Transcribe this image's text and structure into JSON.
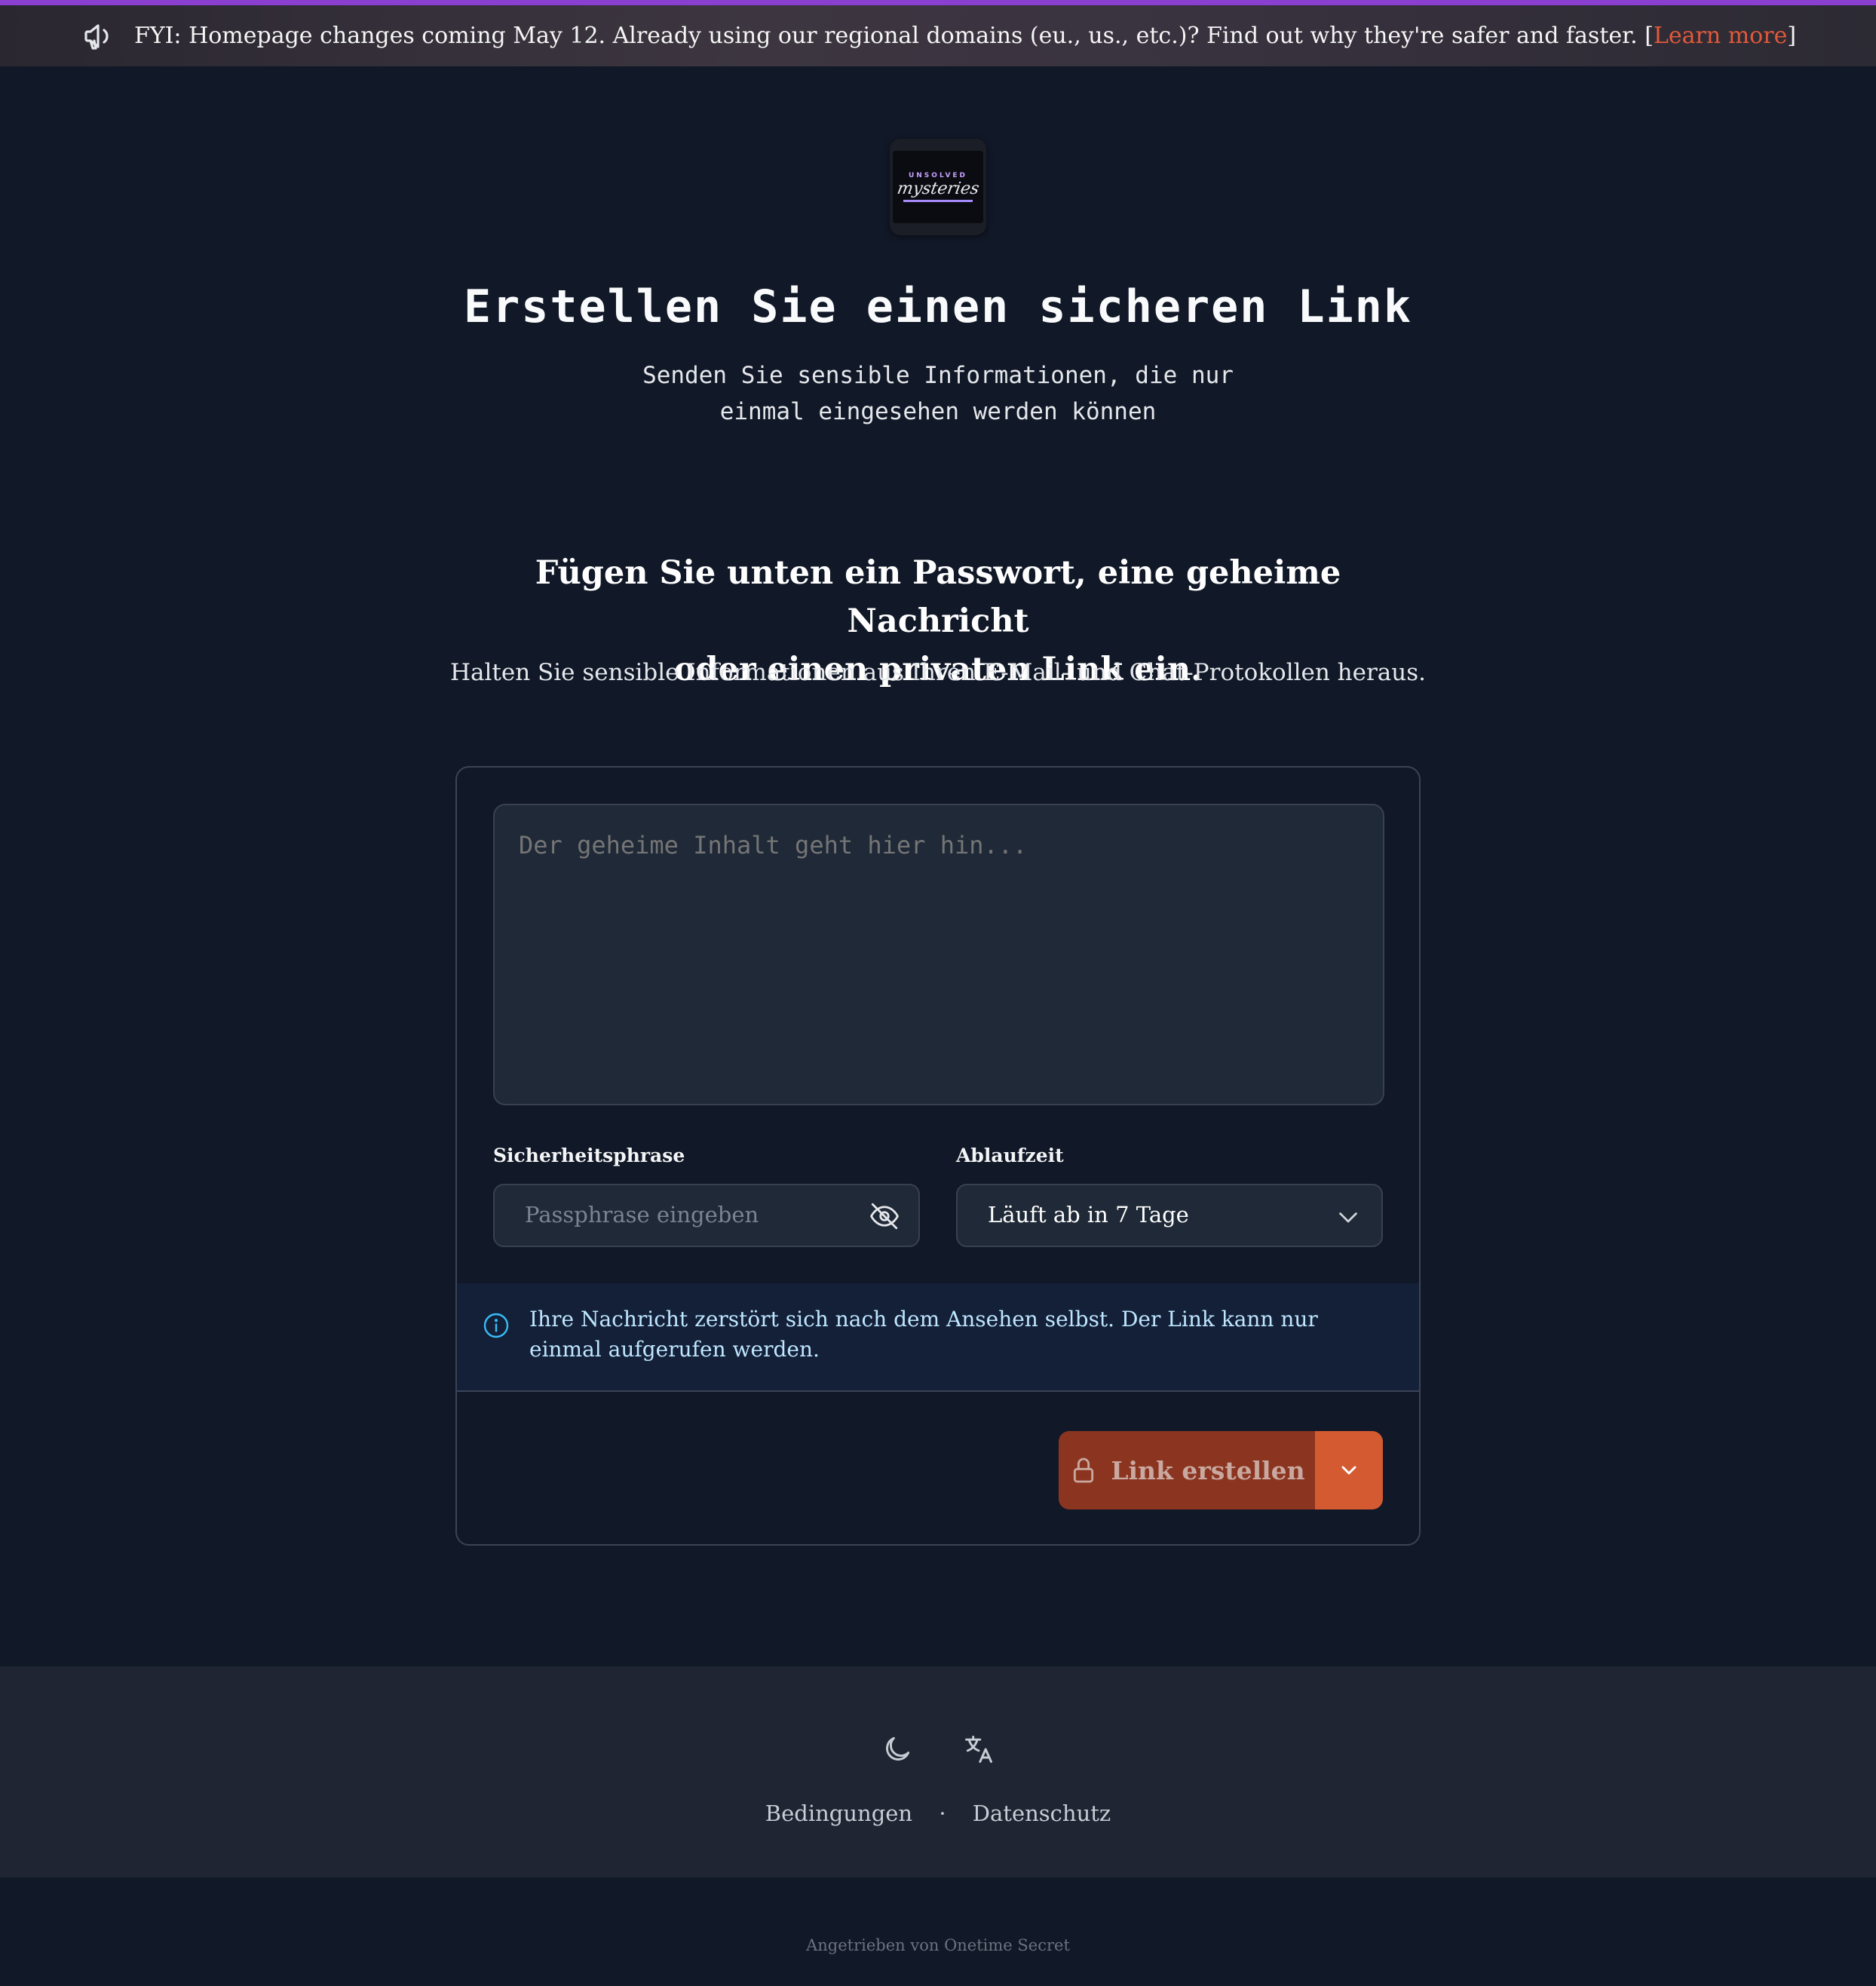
{
  "banner": {
    "text": "FYI: Homepage changes coming May 12. Already using our regional domains (eu., us., etc.)? Find out why they're safer and faster. [",
    "link_label": "Learn more",
    "close_bracket": "]"
  },
  "logo": {
    "top_text": "UNSOLVED",
    "main_text": "mysteries"
  },
  "header": {
    "title": "Erstellen Sie einen sicheren Link",
    "subtitle_line1": "Senden Sie sensible Informationen, die nur",
    "subtitle_line2": "einmal eingesehen werden können"
  },
  "hero": {
    "heading_line1": "Fügen Sie unten ein Passwort, eine geheime Nachricht",
    "heading_line2": "oder einen privaten Link ein.",
    "description": "Halten Sie sensible Informationen aus Ihren E-Mail- und Chat-Protokollen heraus."
  },
  "form": {
    "secret_placeholder": "Der geheime Inhalt geht hier hin...",
    "passphrase_label": "Sicherheitsphrase",
    "passphrase_placeholder": "Passphrase eingeben",
    "expiry_label": "Ablaufzeit",
    "expiry_value": "Läuft ab in 7 Tage",
    "notice": "Ihre Nachricht zerstört sich nach dem Ansehen selbst. Der Link kann nur einmal aufgerufen werden.",
    "submit_label": "Link erstellen"
  },
  "footer": {
    "terms": "Bedingungen",
    "separator": "·",
    "privacy": "Datenschutz",
    "powered_by": "Angetrieben von Onetime Secret"
  },
  "colors": {
    "background": "#111827",
    "accent": "#d45a32",
    "banner_border": "#8b3fd1"
  },
  "icons": [
    "megaphone-icon",
    "eye-off-icon",
    "chevron-down-icon",
    "info-icon",
    "lock-icon",
    "moon-icon",
    "translate-icon"
  ]
}
